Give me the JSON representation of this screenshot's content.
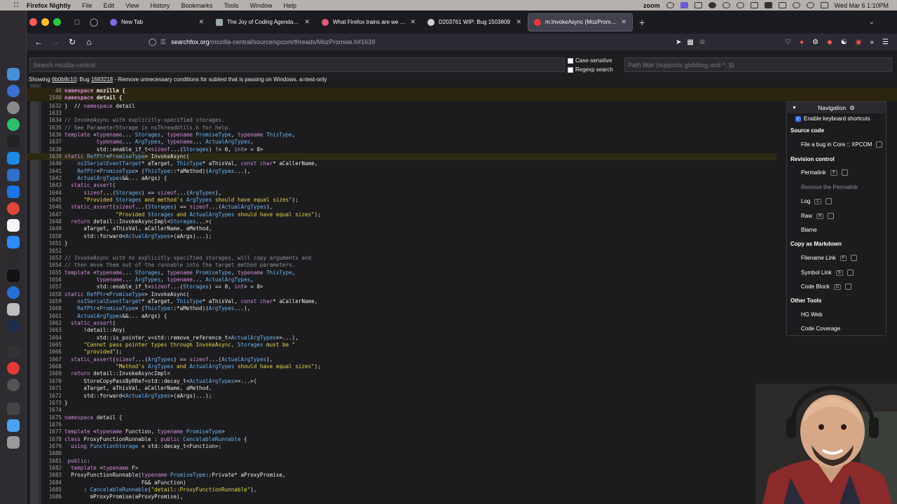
{
  "menubar": {
    "app": "Firefox Nightly",
    "items": [
      "File",
      "Edit",
      "View",
      "History",
      "Bookmarks",
      "Tools",
      "Window",
      "Help"
    ],
    "status_app": "zoom",
    "clock": "Wed Mar 6  1:10PM"
  },
  "tabs": [
    {
      "label": "New Tab",
      "fav_color": "#7a6cf0",
      "active": false
    },
    {
      "label": "The Joy of Coding Agenda - Mo",
      "fav_color": "#9aa",
      "active": false
    },
    {
      "label": "What Firefox trains are we in?",
      "fav_color": "#e05a7a",
      "active": false
    },
    {
      "label": "D203761 WIP: Bug 1503809",
      "fav_color": "#cfcfd8",
      "active": false
    },
    {
      "label": "m:InvokeAsync (MozPromise.h",
      "fav_color": "#e23b3b",
      "active": true
    }
  ],
  "url": {
    "host": "searchfox.org",
    "path": "/mozilla-central/source/xpcom/threads/MozPromise.h#1639"
  },
  "searchfox": {
    "search_placeholder": "Search mozilla-central",
    "case_sensitive": "Case-sensitive",
    "regexp": "Regexp search",
    "path_placeholder": "Path filter (supports globbing and ^, $)",
    "showing_prefix": "Showing ",
    "rev": "6b0b8c10",
    "showing_mid": ": Bug ",
    "bug": "1683218",
    "showing_suffix": " - Remove unnecessary conditions for subtest that is passing on Windows. a=test-only"
  },
  "code_lines": [
    {
      "n": "46",
      "t": "namespace mozilla {"
    },
    {
      "n": "1540",
      "t": "namespace detail {"
    },
    {
      "n": "1632",
      "t": "}  // namespace detail"
    },
    {
      "n": "1633",
      "t": ""
    },
    {
      "n": "1634",
      "t": "// InvokeAsync with explicitly-specified storages."
    },
    {
      "n": "1635",
      "t": "// See ParameterStorage in nsThreadUtils.h for help."
    },
    {
      "n": "1636",
      "t": "template <typename... Storages, typename PromiseType, typename ThisType,"
    },
    {
      "n": "1637",
      "t": "          typename... ArgTypes, typename... ActualArgTypes,"
    },
    {
      "n": "1638",
      "t": "          std::enable_if_t<sizeof...(Storages) != 0, int> = 0>"
    },
    {
      "n": "1639",
      "t": "static RefPtr<PromiseType> InvokeAsync(",
      "hi": true
    },
    {
      "n": "1640",
      "t": "    nsISerialEventTarget* aTarget, ThisType* aThisVal, const char* aCallerName,"
    },
    {
      "n": "1641",
      "t": "    RefPtr<PromiseType> (ThisType::*aMethod)(ArgTypes...),"
    },
    {
      "n": "1642",
      "t": "    ActualArgTypes&&... aArgs) {"
    },
    {
      "n": "1643",
      "t": "  static_assert("
    },
    {
      "n": "1644",
      "t": "      sizeof...(Storages) == sizeof...(ArgTypes),"
    },
    {
      "n": "1645",
      "t": "      \"Provided Storages and method's ArgTypes should have equal sizes\");"
    },
    {
      "n": "1646",
      "t": "  static_assert(sizeof...(Storages) == sizeof...(ActualArgTypes),"
    },
    {
      "n": "1647",
      "t": "                \"Provided Storages and ActualArgTypes should have equal sizes\");"
    },
    {
      "n": "1648",
      "t": "  return detail::InvokeAsyncImpl<Storages...>("
    },
    {
      "n": "1649",
      "t": "      aTarget, aThisVal, aCallerName, aMethod,"
    },
    {
      "n": "1650",
      "t": "      std::forward<ActualArgTypes>(aArgs)...);"
    },
    {
      "n": "1651",
      "t": "}"
    },
    {
      "n": "1652",
      "t": ""
    },
    {
      "n": "1653",
      "t": "// InvokeAsync with no explicitly-specified storages, will copy arguments and"
    },
    {
      "n": "1654",
      "t": "// then move them out of the runnable into the target method parameters."
    },
    {
      "n": "1655",
      "t": "template <typename... Storages, typename PromiseType, typename ThisType,"
    },
    {
      "n": "1656",
      "t": "          typename... ArgTypes, typename... ActualArgTypes,"
    },
    {
      "n": "1657",
      "t": "          std::enable_if_t<sizeof...(Storages) == 0, int> = 0>"
    },
    {
      "n": "1658",
      "t": "static RefPtr<PromiseType> InvokeAsync("
    },
    {
      "n": "1659",
      "t": "    nsISerialEventTarget* aTarget, ThisType* aThisVal, const char* aCallerName,"
    },
    {
      "n": "1660",
      "t": "    RefPtr<PromiseType> (ThisType::*aMethod)(ArgTypes...),"
    },
    {
      "n": "1661",
      "t": "    ActualArgTypes&&... aArgs) {"
    },
    {
      "n": "1662",
      "t": "  static_assert("
    },
    {
      "n": "1663",
      "t": "      !detail::Any("
    },
    {
      "n": "1664",
      "t": "          std::is_pointer_v<std::remove_reference_t<ActualArgTypes>>...),"
    },
    {
      "n": "1665",
      "t": "      \"Cannot pass pointer types through InvokeAsync, Storages must be \""
    },
    {
      "n": "1666",
      "t": "      \"provided\");"
    },
    {
      "n": "1667",
      "t": "  static_assert(sizeof...(ArgTypes) == sizeof...(ActualArgTypes),"
    },
    {
      "n": "1668",
      "t": "                \"Method's ArgTypes and ActualArgTypes should have equal sizes\");"
    },
    {
      "n": "1669",
      "t": "  return detail::InvokeAsyncImpl<"
    },
    {
      "n": "1670",
      "t": "      StoreCopyPassByRRef<std::decay_t<ActualArgTypes>>...>("
    },
    {
      "n": "1671",
      "t": "      aTarget, aThisVal, aCallerName, aMethod,"
    },
    {
      "n": "1672",
      "t": "      std::forward<ActualArgTypes>(aArgs)...);"
    },
    {
      "n": "1673",
      "t": "}"
    },
    {
      "n": "1674",
      "t": ""
    },
    {
      "n": "1675",
      "t": "namespace detail {"
    },
    {
      "n": "1676",
      "t": ""
    },
    {
      "n": "1677",
      "t": "template <typename Function, typename PromiseType>"
    },
    {
      "n": "1678",
      "t": "class ProxyFunctionRunnable : public CancelableRunnable {"
    },
    {
      "n": "1679",
      "t": "  using FunctionStorage = std::decay_t<Function>;"
    },
    {
      "n": "1680",
      "t": ""
    },
    {
      "n": "1681",
      "t": " public:"
    },
    {
      "n": "1682",
      "t": "  template <typename F>"
    },
    {
      "n": "1683",
      "t": "  ProxyFunctionRunnable(typename PromiseType::Private* aProxyPromise,"
    },
    {
      "n": "1684",
      "t": "                        F&& aFunction)"
    },
    {
      "n": "1685",
      "t": "      : CancelableRunnable(\"detail::ProxyFunctionRunnable\"),"
    },
    {
      "n": "1686",
      "t": "        mProxyPromise(aProxyPromise),"
    }
  ],
  "navigation": {
    "title": "Navigation",
    "enable_shortcuts": "Enable keyboard shortcuts",
    "source_code": "Source code",
    "file_bug": "File a bug in Core :: XPCOM",
    "revision_control": "Revision control",
    "permalink": "Permalink",
    "permalink_key": "Y",
    "remove_permalink": "Remove the Permalink",
    "log": "Log",
    "log_key": "L",
    "raw": "Raw",
    "raw_key": "R",
    "blame": "Blame",
    "copy_markdown": "Copy as Markdown",
    "filename_link": "Filename Link",
    "filename_key": "F",
    "symbol_link": "Symbol Link",
    "symbol_key": "S",
    "code_block": "Code Block",
    "code_key": "C",
    "other_tools": "Other Tools",
    "hg_web": "HG Web",
    "code_coverage": "Code Coverage"
  },
  "colors": {
    "keyword": "#d08bd8",
    "string": "#e8d44d",
    "comment": "#8e8e94",
    "type": "#6db3f2",
    "accent": "#3478f6",
    "sticky": "#2a2411"
  }
}
